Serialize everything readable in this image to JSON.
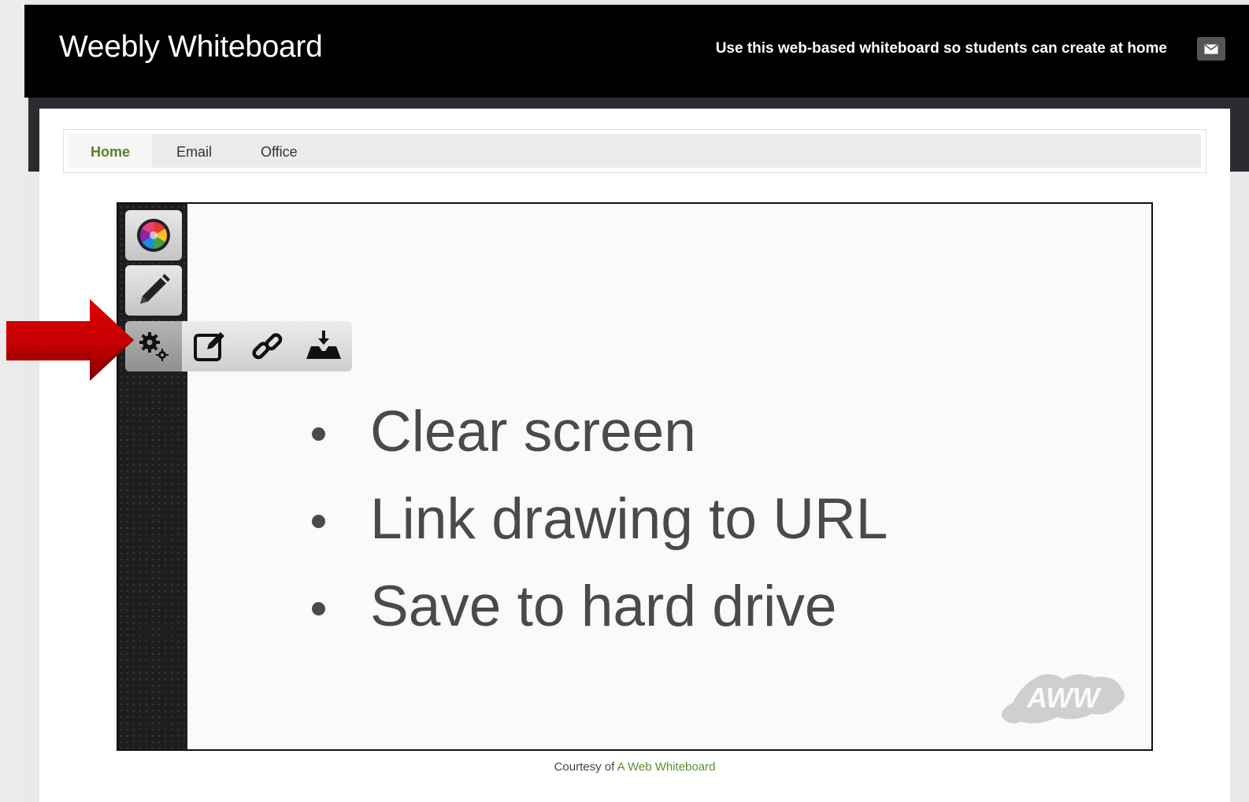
{
  "header": {
    "title": "Weebly Whiteboard",
    "tagline": "Use this web-based whiteboard so students can create at home",
    "mail_icon": "envelope-icon"
  },
  "nav": {
    "items": [
      {
        "label": "Home",
        "active": true
      },
      {
        "label": "Email",
        "active": false
      },
      {
        "label": "Office",
        "active": false
      }
    ]
  },
  "whiteboard": {
    "tools": [
      "color-wheel-icon",
      "pencil-icon"
    ],
    "menu_row": [
      "gears-icon",
      "edit-icon",
      "link-icon",
      "save-tray-icon"
    ],
    "bullets": [
      "Clear screen",
      "Link drawing to URL",
      "Save to hard drive"
    ],
    "logo_text": "AWW"
  },
  "footer": {
    "prefix": "Courtesy of",
    "link": "A Web Whiteboard"
  },
  "colors": {
    "nav_active": "#5a7f2a",
    "footer_link": "#5a8f2a",
    "arrow": "#cc0000"
  }
}
